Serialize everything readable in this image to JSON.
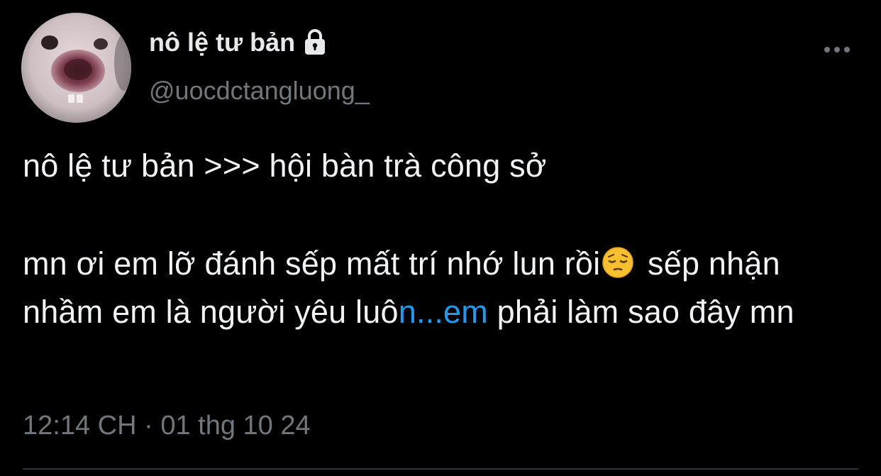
{
  "author": {
    "display_name": "nô lệ tư bản",
    "handle": "@uocdctangluong_",
    "protected_icon": "lock-icon",
    "avatar_icon": "pig-face-avatar"
  },
  "more_icon": "more-horizontal-icon",
  "tweet": {
    "line1": "nô lệ tư bản >>> hội bàn trà công sở",
    "para2_part1": "mn ơi em lỡ đánh sếp mất trí nhớ lun rồi",
    "emoji_icon": "pensive-face-emoji",
    "para2_part2": " sếp nhận nhầm em là người yêu luô",
    "link_text": "n...em",
    "para2_part3": " phải làm sao đây mn"
  },
  "meta": {
    "time": "12:14 CH",
    "separator": " · ",
    "date": "01 thg 10 24"
  },
  "colors": {
    "background": "#000000",
    "primary_text": "#e7e9ea",
    "secondary_text": "#71767b",
    "link": "#1d9bf0",
    "divider": "#2f3336"
  }
}
